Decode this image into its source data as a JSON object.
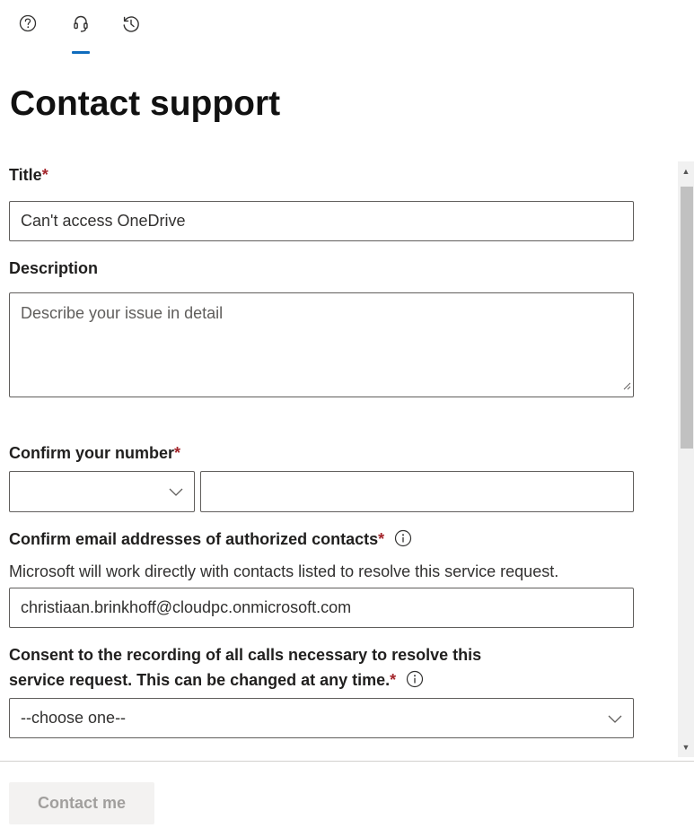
{
  "tabs": [
    {
      "icon": "help-icon"
    },
    {
      "icon": "headset-icon",
      "active": true
    },
    {
      "icon": "history-icon"
    }
  ],
  "page": {
    "title": "Contact support"
  },
  "form": {
    "title": {
      "label": "Title",
      "required": "*",
      "value": "Can't access OneDrive"
    },
    "description": {
      "label": "Description",
      "placeholder": "Describe your issue in detail"
    },
    "phone": {
      "label": "Confirm your number",
      "required": "*",
      "country_value": "",
      "number_value": ""
    },
    "contacts": {
      "label": "Confirm email addresses of authorized contacts",
      "required": "*",
      "helper": "Microsoft will work directly with contacts listed to resolve this service request.",
      "value": "christiaan.brinkhoff@cloudpc.onmicrosoft.com"
    },
    "consent": {
      "label_line1": "Consent to the recording of all calls necessary to resolve this",
      "label_line2": "service request. This can be changed at any time.",
      "required": "*",
      "selected": "--choose one--"
    }
  },
  "footer": {
    "contact_button": "Contact me"
  },
  "colors": {
    "accent": "#0f6cbd",
    "required": "#a4262c",
    "disabled_text": "#a19f9d"
  }
}
